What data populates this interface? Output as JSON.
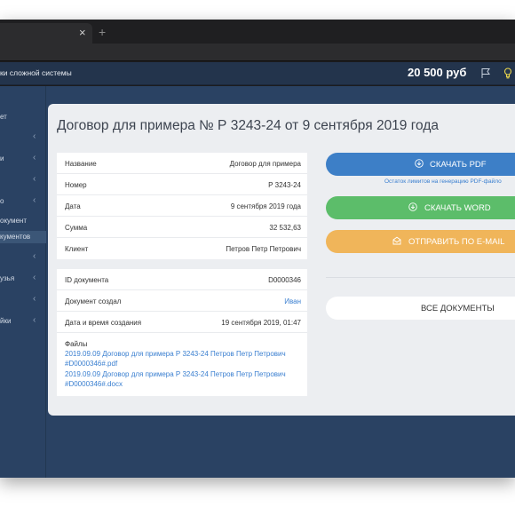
{
  "browser": {
    "tab_close": "×",
    "new_tab": "+"
  },
  "header": {
    "app_title": "ки сложной системы",
    "balance": "20 500 руб",
    "icons": [
      "flag-icon",
      "lightbulb-icon"
    ]
  },
  "sidebar": {
    "items": [
      {
        "label": "ет",
        "chevron": ""
      },
      {
        "label": "",
        "chevron": "‹"
      },
      {
        "label": "и",
        "chevron": "‹"
      },
      {
        "label": "",
        "chevron": "‹"
      },
      {
        "label": "о",
        "chevron": "‹"
      },
      {
        "label": "окумент",
        "chevron": ""
      },
      {
        "label": "кументов",
        "chevron": ""
      },
      {
        "label": "",
        "chevron": "‹"
      },
      {
        "label": "узья",
        "chevron": "‹"
      },
      {
        "label": "",
        "chevron": "‹"
      },
      {
        "label": "йки",
        "chevron": "‹"
      }
    ]
  },
  "document": {
    "title": "Договор для примера № Р 3243-24 от 9 сентября 2019 года",
    "details": [
      {
        "key": "Название",
        "value": "Договор для примера"
      },
      {
        "key": "Номер",
        "value": "Р 3243-24"
      },
      {
        "key": "Дата",
        "value": "9 сентября 2019 года"
      },
      {
        "key": "Сумма",
        "value": "32 532,63"
      },
      {
        "key": "Клиент",
        "value": "Петров Петр Петрович"
      }
    ],
    "meta": [
      {
        "key": "ID документа",
        "value": "D0000346"
      },
      {
        "key": "Документ создал",
        "value": "Иван"
      },
      {
        "key": "Дата и время создания",
        "value": "19 сентября 2019, 01:47"
      }
    ],
    "files_label": "Файлы",
    "files": [
      "2019.09.09 Договор для примера Р 3243-24 Петров Петр Петрович #D0000346#.pdf",
      "2019.09.09 Договор для примера Р 3243-24 Петров Петр Петрович #D0000346#.docx"
    ]
  },
  "actions": {
    "download_pdf": "СКАЧАТЬ PDF",
    "pdf_note": "Остаток лимитов на генерацию PDF-файло",
    "download_word": "СКАЧАТЬ WORD",
    "send_email": "ОТПРАВИТЬ ПО E-MAIL",
    "all_documents": "ВСЕ ДОКУМЕНТЫ"
  },
  "colors": {
    "header_bg": "#23344c",
    "sidebar_bg": "#2a4263",
    "pdf_button": "#3d7fc7",
    "word_button": "#5cbd6a",
    "email_button": "#f0b55a",
    "link": "#3a7fd0"
  }
}
